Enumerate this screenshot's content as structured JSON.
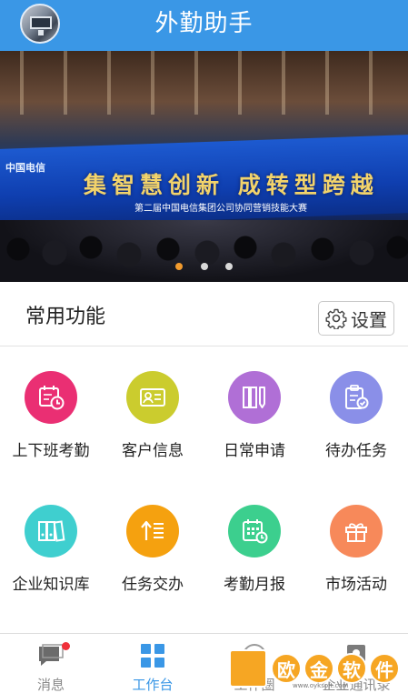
{
  "header": {
    "title": "外勤助手"
  },
  "banner": {
    "logo_text": "中国电信",
    "slogan": "集智慧创新 成转型跨越",
    "subtitle": "第二届中国电信集团公司协同营销技能大赛",
    "dots": 3,
    "active_dot": 0
  },
  "section": {
    "title": "常用功能",
    "settings_label": "设置"
  },
  "features": [
    {
      "label": "上下班考勤",
      "icon": "calendar-clock-icon",
      "color": "#ea2f73"
    },
    {
      "label": "客户信息",
      "icon": "id-card-icon",
      "color": "#cbcc2e"
    },
    {
      "label": "日常申请",
      "icon": "books-pen-icon",
      "color": "#b06fd6"
    },
    {
      "label": "待办任务",
      "icon": "clipboard-check-icon",
      "color": "#8a8fe8"
    },
    {
      "label": "企业知识库",
      "icon": "binders-icon",
      "color": "#3fcfcf"
    },
    {
      "label": "任务交办",
      "icon": "upload-list-icon",
      "color": "#f5a10f"
    },
    {
      "label": "考勤月报",
      "icon": "monthly-calendar-icon",
      "color": "#3ccf8e"
    },
    {
      "label": "市场活动",
      "icon": "gift-icon",
      "color": "#f7895a"
    }
  ],
  "tabs": [
    {
      "label": "消息",
      "icon": "message-icon",
      "active": false,
      "badge": true
    },
    {
      "label": "工作台",
      "icon": "workbench-grid-icon",
      "active": true
    },
    {
      "label": "工作圈",
      "icon": "work-circle-icon",
      "active": false
    },
    {
      "label": "企业通讯录",
      "icon": "contacts-icon",
      "active": false
    }
  ],
  "colors": {
    "primary": "#3a97e6",
    "badge": "#f0303a",
    "dot_active": "#f29b2e"
  },
  "watermark": {
    "text": "欧金软件园",
    "url": "www.oyksoft.com"
  }
}
